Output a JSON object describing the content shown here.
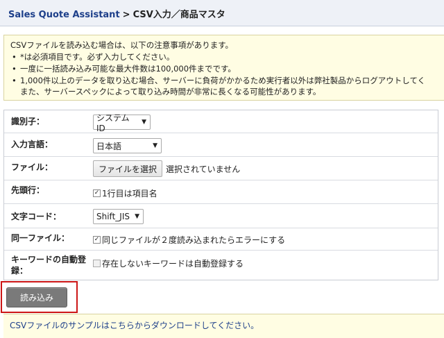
{
  "header": {
    "app_link": "Sales Quote Assistant",
    "separator": ">",
    "current": "CSV入力／商品マスタ"
  },
  "notice": {
    "intro": "CSVファイルを読み込む場合は、以下の注意事項があります。",
    "items": [
      "*は必須項目です。必ず入力してください。",
      "一度に一括読み込み可能な最大件数は100,000件までです。",
      "1,000件以上のデータを取り込む場合、サーバーに負荷がかかるため実行者以外は弊社製品からログアウトしてく"
    ],
    "item_cont": "また、サーバースペックによって取り込み時間が非常に長くなる可能性があります。"
  },
  "form": {
    "identifier": {
      "label": "識別子：",
      "value": "システムID"
    },
    "language": {
      "label": "入力言語：",
      "value": "日本語"
    },
    "file": {
      "label": "ファイル：",
      "button": "ファイルを選択",
      "status": "選択されていません"
    },
    "header_row": {
      "label": "先頭行：",
      "checkbox": "1行目は項目名",
      "checked": true
    },
    "encoding": {
      "label": "文字コード：",
      "value": "Shift_JIS"
    },
    "same_file": {
      "label": "同一ファイル：",
      "checkbox": "同じファイルが２度読み込まれたらエラーにする",
      "checked": true
    },
    "keyword": {
      "label_line1": "キーワードの自動登",
      "label_line2": "録：",
      "checkbox": "存在しないキーワードは自動登録する",
      "checked": false
    }
  },
  "submit_label": "読み込み",
  "footer_link": "CSVファイルのサンプルはこちらからダウンロードしてください。",
  "colors": {
    "link": "#1d3f8a",
    "notice_bg": "#fffde3",
    "highlight": "#cc1515",
    "button": "#7a7a7a"
  }
}
